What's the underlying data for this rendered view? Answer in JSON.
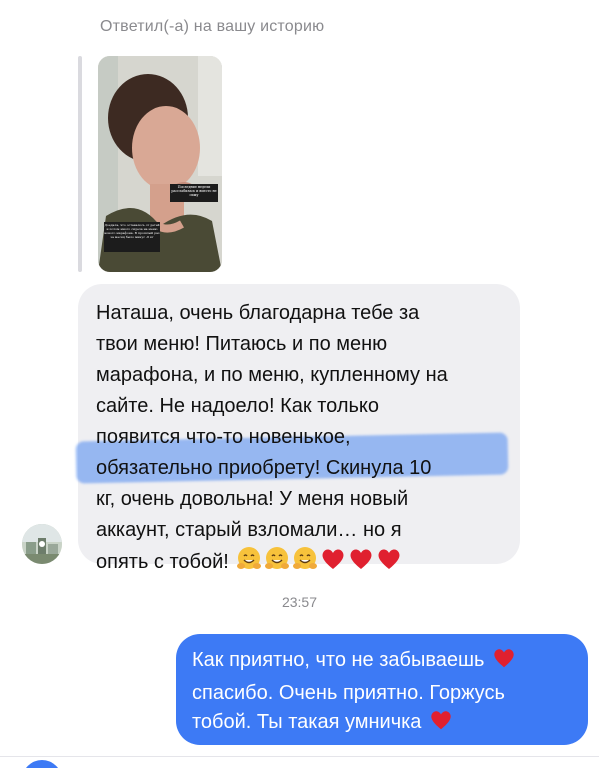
{
  "header": {
    "reply_label": "Ответил(-а) на вашу историю"
  },
  "story": {
    "caption_top": "Последние недели расслабилась и вместо не сижу",
    "caption_bottom": "Доедала, что оставалось от детей и потом много сидела на меню нового марафона. В прошлый раз за месяц было минус -6 кг"
  },
  "incoming_message": {
    "text": "Наташа, очень благодарна тебе за твои меню! Питаюсь и по меню марафона, и по меню, купленному на сайте. Не надоело! Как только появится что-то новенькое, обязательно приобрету! Скинула 10 кг, очень довольна! У меня новый аккаунт, старый взломали… но я опять с тобой!",
    "lines": [
      "Наташа, очень благодарна тебе за",
      "твои меню! Питаюсь и по меню",
      "марафона, и по меню, купленному на",
      "сайте. Не надоело! Как только",
      "появится что-то новенькое,",
      "обязательно приобрету! Скинула 10",
      "кг, очень довольна! У меня новый",
      "аккаунт, старый взломали… но я",
      "опять с тобой!"
    ],
    "emojis": [
      "hugging-face-icon",
      "hugging-face-icon",
      "hugging-face-icon",
      "red-heart-icon",
      "red-heart-icon",
      "red-heart-icon"
    ],
    "highlight_color": "#4c88f0"
  },
  "timestamp": "23:57",
  "outgoing_message": {
    "lines": [
      "Как приятно, что не забываешь",
      "спасибо. Очень приятно. Горжусь",
      "тобой. Ты такая умничка"
    ],
    "emojis": [
      "red-heart-icon",
      "red-heart-icon"
    ]
  },
  "colors": {
    "outgoing_bubble": "#3d7af5",
    "incoming_bubble": "#efeff2",
    "meta_text": "#8a8a8e"
  }
}
